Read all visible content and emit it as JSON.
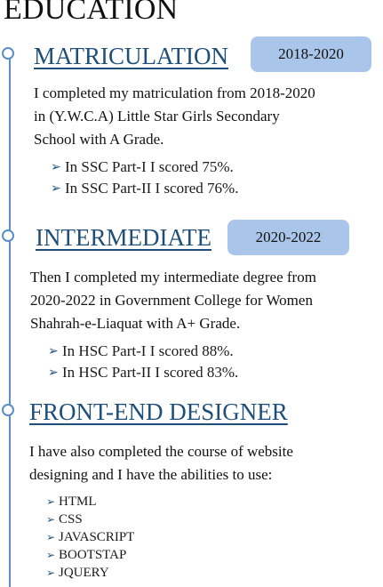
{
  "page_title": "EDUCATION",
  "sections": [
    {
      "title": "MATRICULATION",
      "date": "2018-2020",
      "lines": [
        "I completed my matriculation from 2018-2020",
        "in (Y.W.C.A) Little Star Girls Secondary",
        "School with A Grade."
      ],
      "bullets": [
        "In SSC Part-I I scored 75%.",
        "In SSC Part-II I scored 76%."
      ]
    },
    {
      "title": "INTERMEDIATE",
      "date": "2020-2022",
      "lines": [
        "Then I completed my intermediate degree from",
        "2020-2022 in Government College for Women",
        "Shahrah-e-Liaquat with A+ Grade."
      ],
      "bullets": [
        "In HSC Part-I I scored 88%.",
        "In HSC Part-II I scored 83%."
      ]
    },
    {
      "title": "FRONT-END DESIGNER",
      "lines": [
        "I have also completed the course of website",
        "designing and I have the abilities to use:"
      ],
      "bullets": [
        "HTML",
        "CSS",
        "JAVASCRIPT",
        "BOOTSTAP",
        "JQUERY"
      ]
    }
  ],
  "colors": {
    "accent": "#1f4e79",
    "timeline": "#5b8ec9",
    "badge": "#a9c6ea"
  },
  "icons": {
    "node": "timeline-circle-icon",
    "bullet": "arrow-right-icon"
  }
}
